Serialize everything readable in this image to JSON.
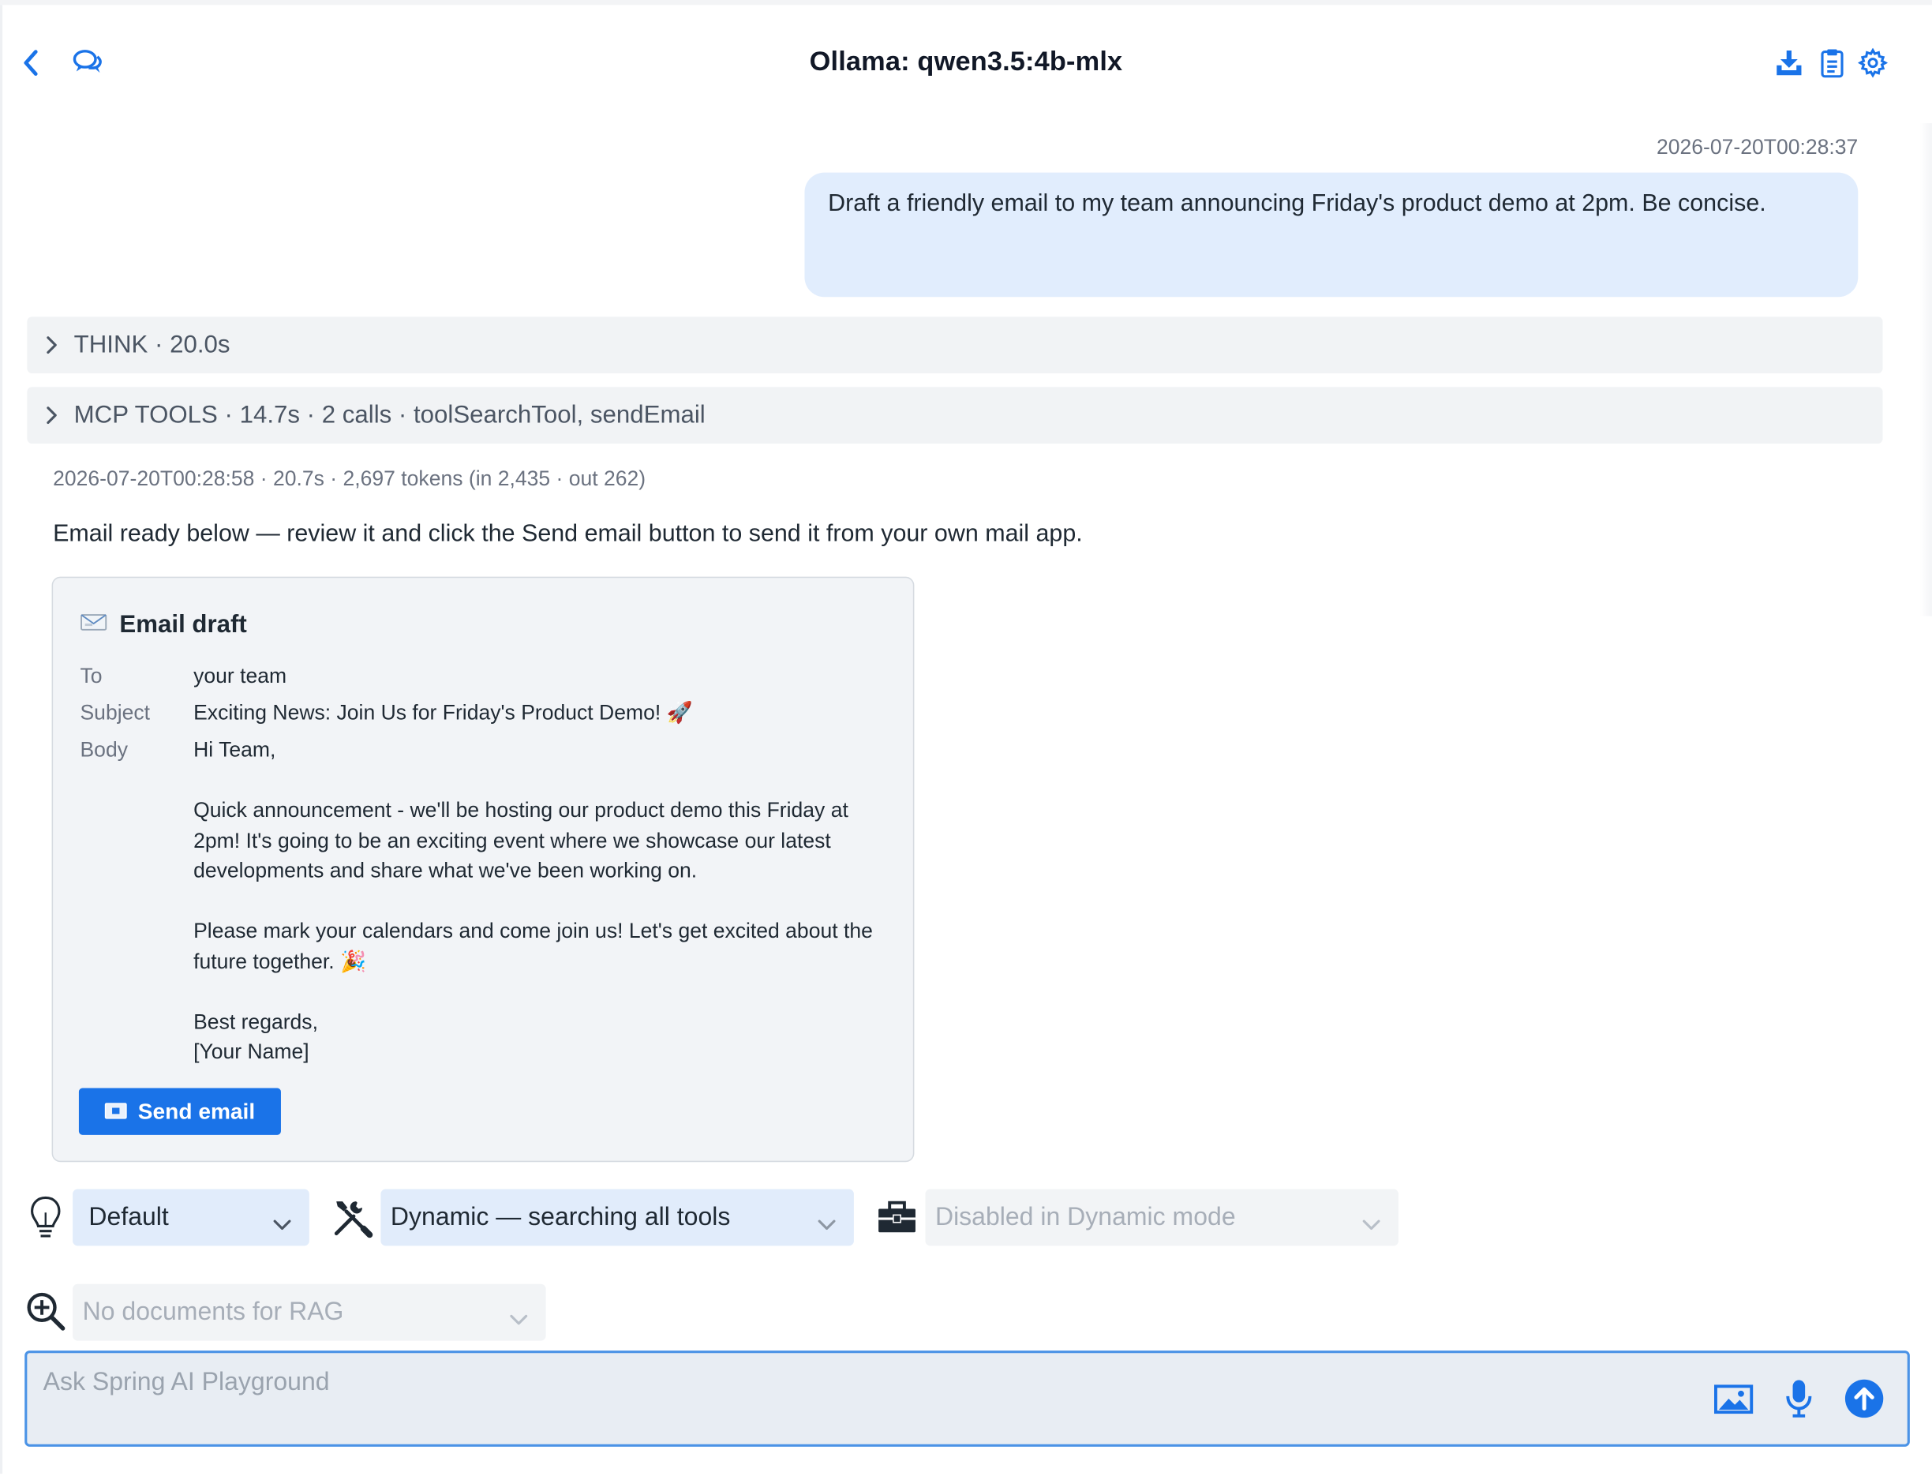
{
  "header": {
    "title": "Ollama: qwen3.5:4b-mlx",
    "back_icon": "chevron-left-icon",
    "conversations_icon": "chat-bubbles-icon",
    "download_icon": "download-icon",
    "clipboard_icon": "clipboard-icon",
    "settings_icon": "gear-icon"
  },
  "conversation": {
    "user_timestamp": "2026-07-20T00:28:37",
    "user_message": "Draft a friendly email to my team announcing Friday's product demo at 2pm. Be concise.",
    "think_label": "THINK · 20.0s",
    "tools_label": "MCP TOOLS · 14.7s · 2 calls · toolSearchTool, sendEmail",
    "response_meta": "2026-07-20T00:28:58 · 20.7s · 2,697 tokens (in 2,435 · out 262)",
    "response_text": "Email ready below — review it and click the Send email button to send it from your own mail app."
  },
  "email_card": {
    "title": "Email draft",
    "to_label": "To",
    "to_value": "your team",
    "subject_label": "Subject",
    "subject_value": "Exciting News: Join Us for Friday's Product Demo! 🚀",
    "body_label": "Body",
    "body_value": "Hi Team,\n\nQuick announcement - we'll be hosting our product demo this Friday at 2pm! It's going to be an exciting event where we showcase our latest developments and share what we've been working on.\n\nPlease mark your calendars and come join us! Let's get excited about the future together. 🎉\n\nBest regards,\n[Your Name]",
    "send_label": "Send email"
  },
  "controls": {
    "prompt_select": "Default",
    "tools_select": "Dynamic — searching all tools",
    "toolbox_select": "Disabled in Dynamic mode",
    "rag_select": "No documents for RAG"
  },
  "input": {
    "placeholder": "Ask Spring AI Playground"
  },
  "colors": {
    "accent": "#1a73e8",
    "user_bubble": "#e1edfd",
    "card_bg": "#f2f4f7"
  }
}
